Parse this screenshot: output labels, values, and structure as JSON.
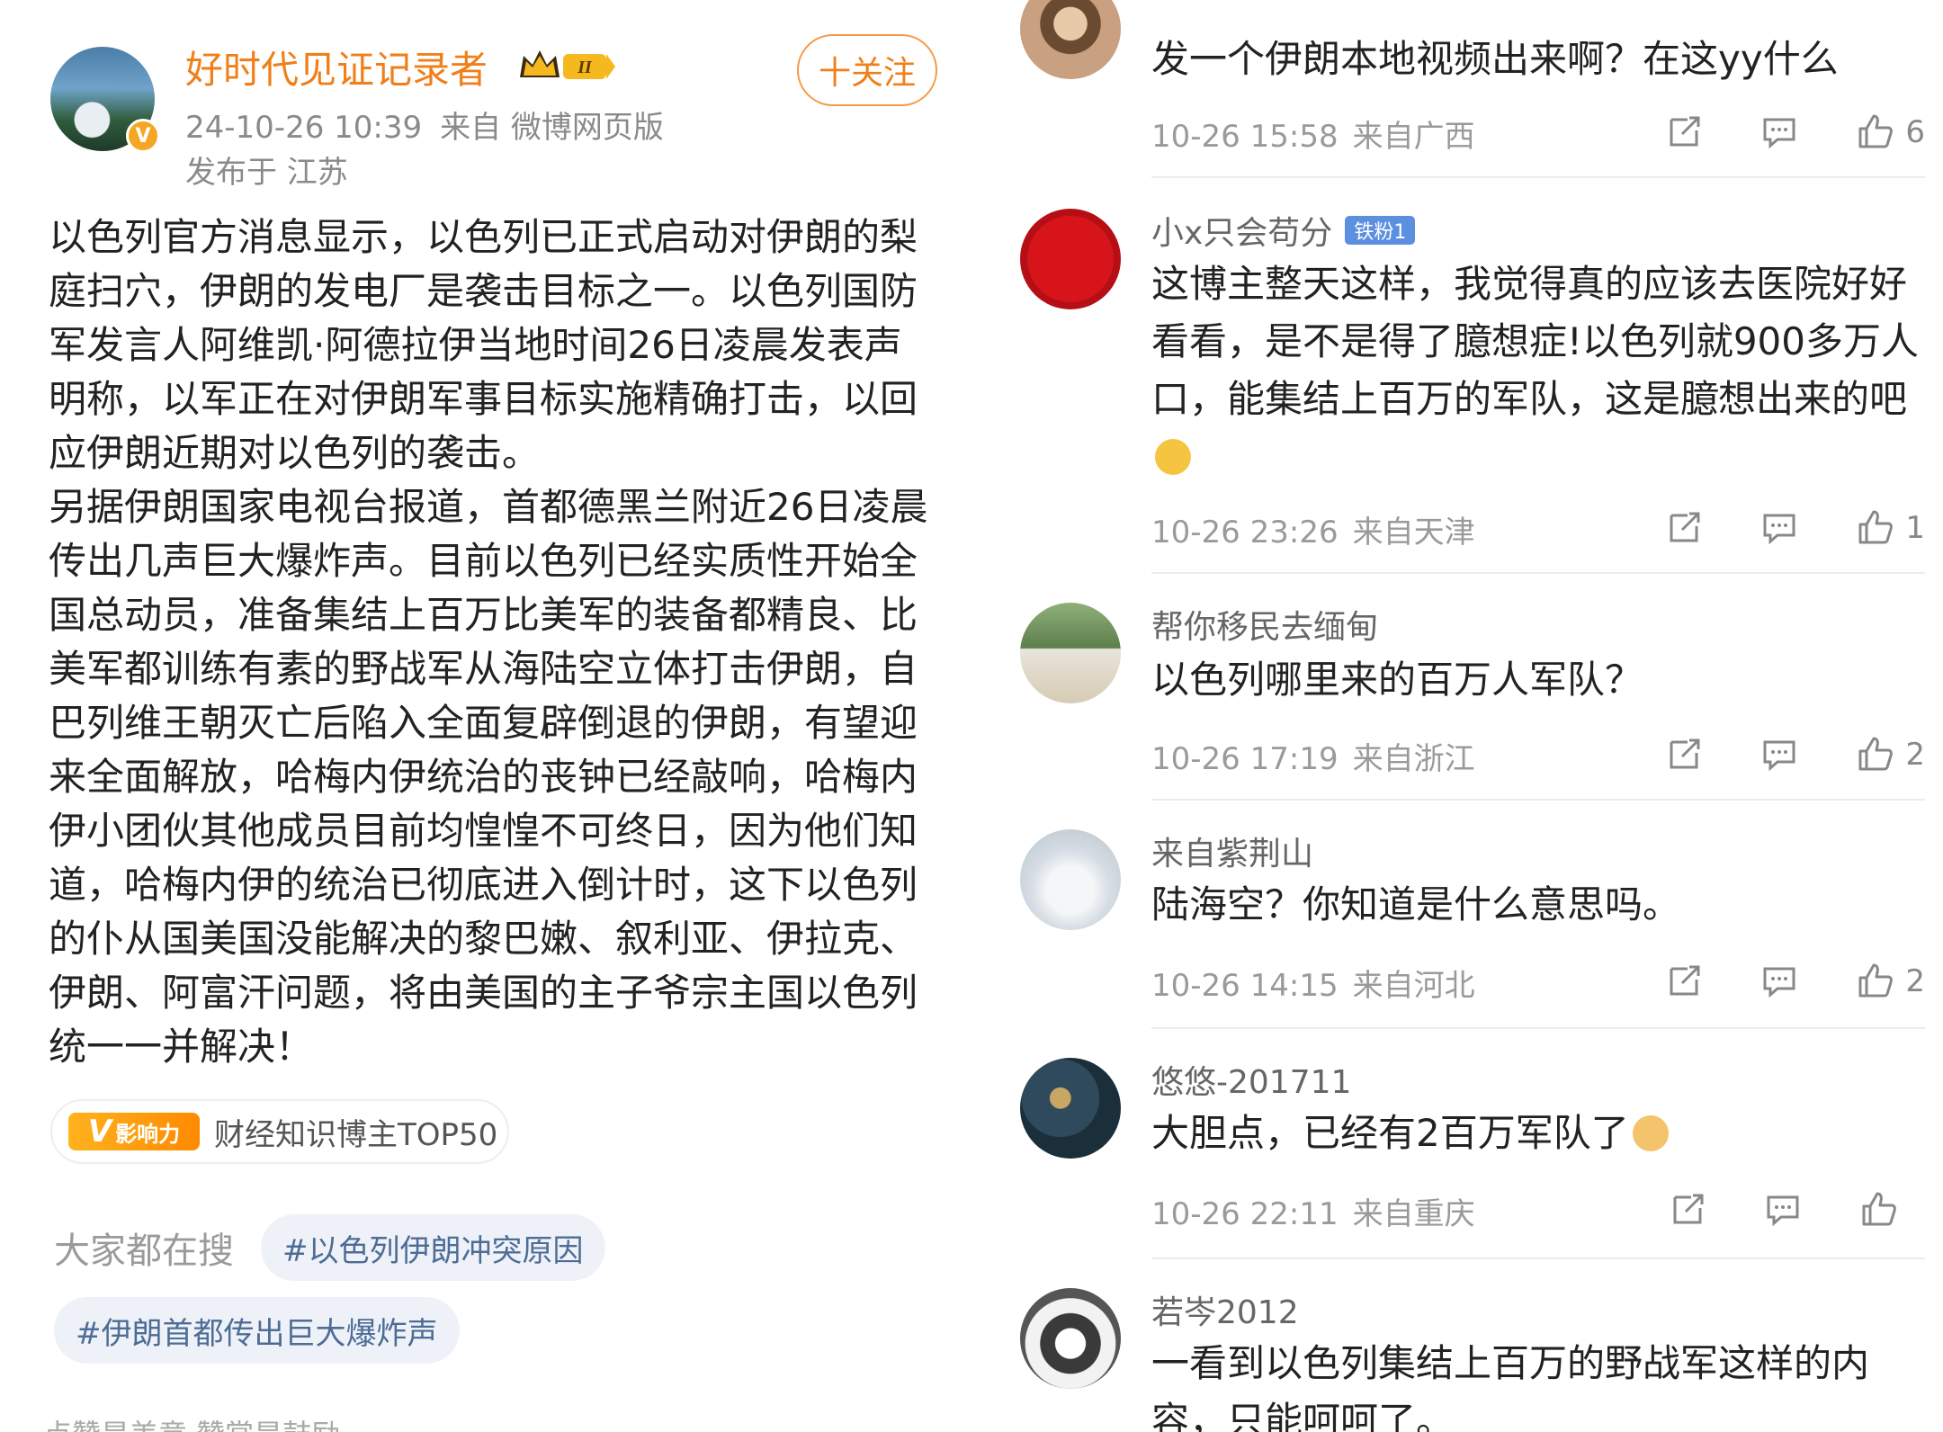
{
  "post": {
    "author": "好时代见证记录者",
    "follow_label": "十关注",
    "timestamp": "24-10-26 10:39",
    "source": "来自 微博网页版",
    "location": "发布于 江苏",
    "paragraph1": "以色列官方消息显示，以色列已正式启动对伊朗的梨庭扫穴，伊朗的发电厂是袭击目标之一。以色列国防军发言人阿维凯·阿德拉伊当地时间26日凌晨发表声明称，以军正在对伊朗军事目标实施精确打击，以回应伊朗近期对以色列的袭击。",
    "paragraph2": "另据伊朗国家电视台报道，首都德黑兰附近26日凌晨传出几声巨大爆炸声。目前以色列已经实质性开始全国总动员，准备集结上百万比美军的装备都精良、比美军都训练有素的野战军从海陆空立体打击伊朗，自巴列维王朝灭亡后陷入全面复辟倒退的伊朗，有望迎来全面解放，哈梅内伊统治的丧钟已经敲响，哈梅内伊小团伙其他成员目前均惶惶不可终日，因为他们知道，哈梅内伊的统治已彻底进入倒计时，这下以色列的仆从国美国没能解决的黎巴嫩、叙利亚、伊拉克、伊朗、阿富汗问题，将由美国的主子爷宗主国以色列统一一并解决！",
    "influence_badge": "影响力",
    "influence_text": "财经知识博主TOP50",
    "search_label": "大家都在搜",
    "tags": [
      "#以色列伊朗冲突原因",
      "#伊朗首都传出巨大爆炸声"
    ],
    "bottom_text": "点赞是美意  赞赏是鼓励"
  },
  "comments": [
    {
      "user": "",
      "text": "发一个伊朗本地视频出来啊？在这yy什么",
      "time": "10-26 15:58",
      "location": "来自广西",
      "likes": "6"
    },
    {
      "user": "小x只会苟分",
      "badge": "铁粉1",
      "text": "这博主整天这样，我觉得真的应该去医院好好看看，是不是得了臆想症!以色列就900多万人口，能集结上百万的军队，这是臆想出来的吧",
      "time": "10-26 23:26",
      "location": "来自天津",
      "likes": "1"
    },
    {
      "user": "帮你移民去缅甸",
      "text": "以色列哪里来的百万人军队？",
      "time": "10-26 17:19",
      "location": "来自浙江",
      "likes": "2"
    },
    {
      "user": "来自紫荆山",
      "text": "陆海空？你知道是什么意思吗。",
      "time": "10-26 14:15",
      "location": "来自河北",
      "likes": "2"
    },
    {
      "user": "悠悠-201711",
      "text": "大胆点，已经有2百万军队了",
      "time": "10-26 22:11",
      "location": "来自重庆",
      "likes": ""
    },
    {
      "user": "若岑2012",
      "text": "一看到以色列集结上百万的野战军这样的内容，只能呵呵了。"
    }
  ],
  "colors": {
    "accent_orange": "#f07f1a",
    "tag_blue": "#4d6c96",
    "badge_blue": "#5b8fe0"
  }
}
